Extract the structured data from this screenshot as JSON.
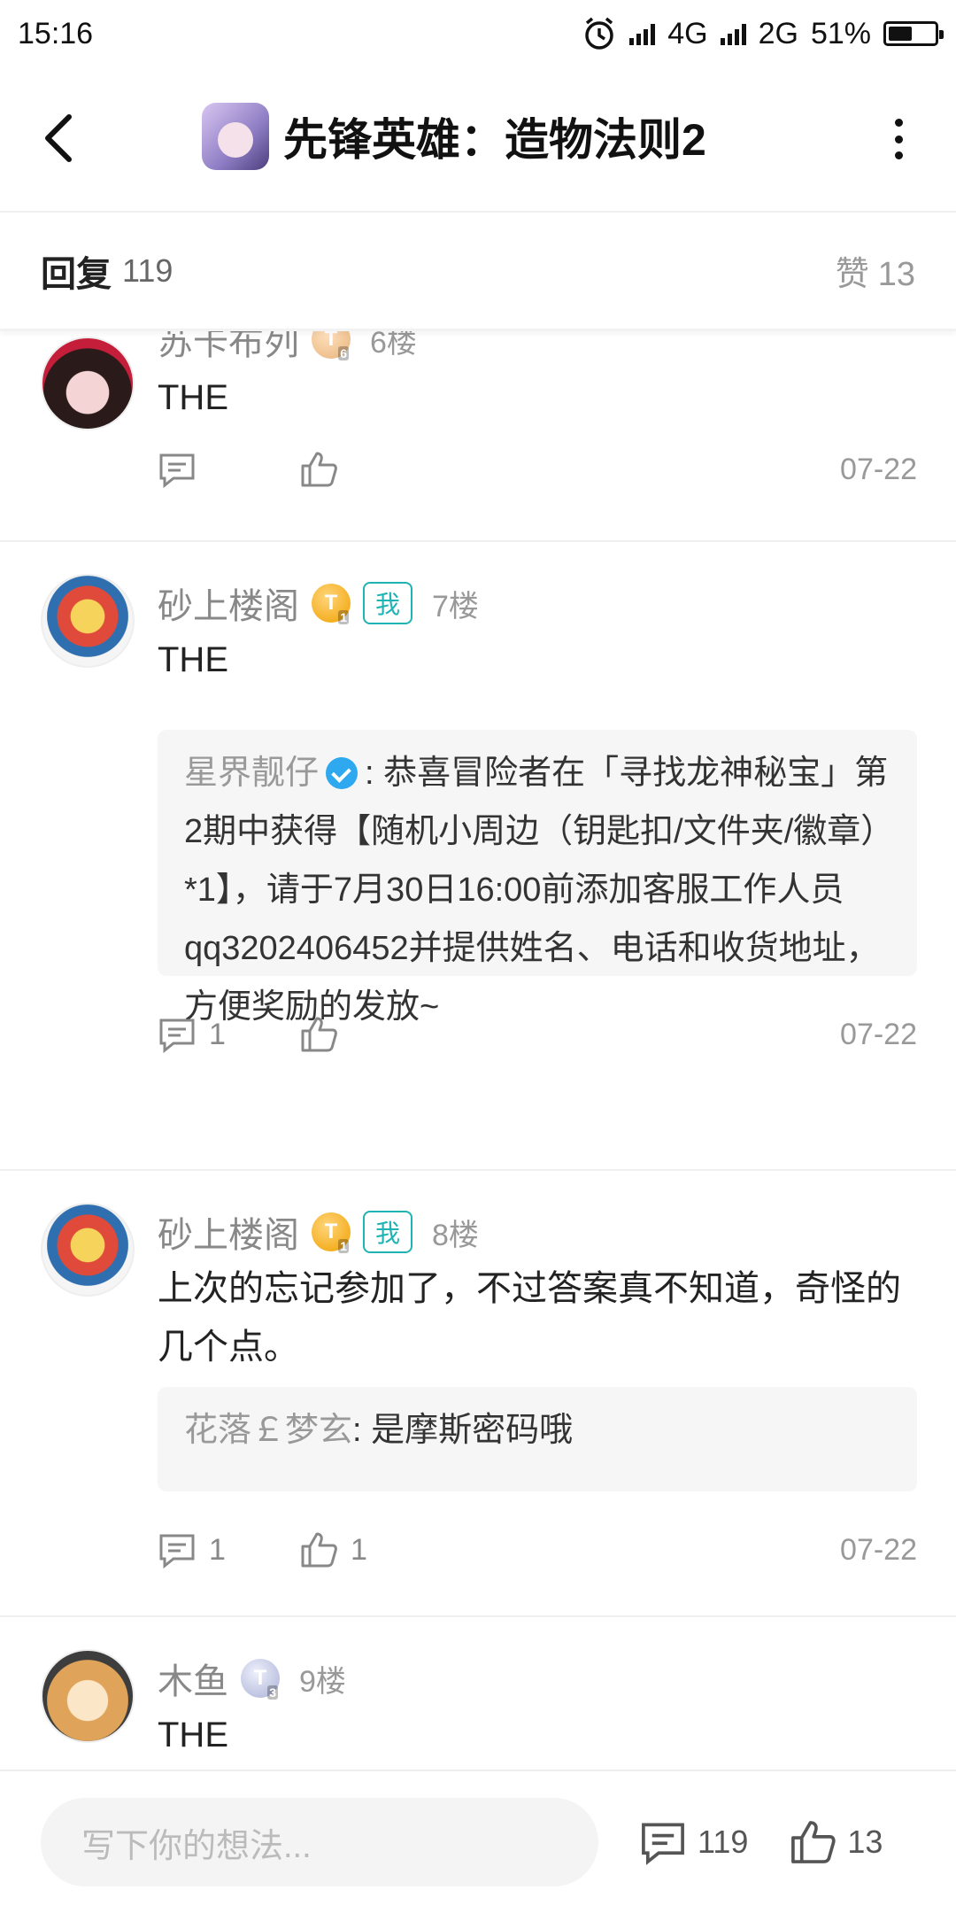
{
  "status": {
    "time": "15:16",
    "network1": "4G",
    "network2": "2G",
    "battery": "51%",
    "battery_level": 0.51
  },
  "header": {
    "title": "先锋英雄：造物法则2"
  },
  "replies_bar": {
    "label": "回复",
    "count": "119",
    "likes_label": "赞",
    "likes_count": "13"
  },
  "posts": [
    {
      "user": "苏卡布列",
      "level": "T",
      "level_sub": "6",
      "floor": "6楼",
      "content": "THE",
      "comment_count": "",
      "like_count": "",
      "date": "07-22"
    },
    {
      "user": "砂上楼阁",
      "level": "T",
      "level_sub": "1",
      "me": "我",
      "floor": "7楼",
      "content": "THE",
      "quote": {
        "name": "星界靓仔",
        "text": ": 恭喜冒险者在「寻找龙神秘宝」第2期中获得【随机小周边（钥匙扣/文件夹/徽章）*1】，请于7月30日16:00前添加客服工作人员qq3202406452并提供姓名、电话和收货地址，方便奖励的发放~"
      },
      "comment_count": "1",
      "like_count": "",
      "date": "07-22"
    },
    {
      "user": "砂上楼阁",
      "level": "T",
      "level_sub": "1",
      "me": "我",
      "floor": "8楼",
      "content": "上次的忘记参加了，不过答案真不知道，奇怪的几个点。",
      "quote": {
        "name": "花落￡梦玄",
        "text": ": 是摩斯密码哦"
      },
      "comment_count": "1",
      "like_count": "1",
      "date": "07-22"
    },
    {
      "user": "木鱼",
      "level": "T",
      "level_sub": "3",
      "floor": "9楼",
      "content": "THE"
    }
  ],
  "bottom": {
    "placeholder": "写下你的想法...",
    "comments": "119",
    "likes": "13"
  }
}
